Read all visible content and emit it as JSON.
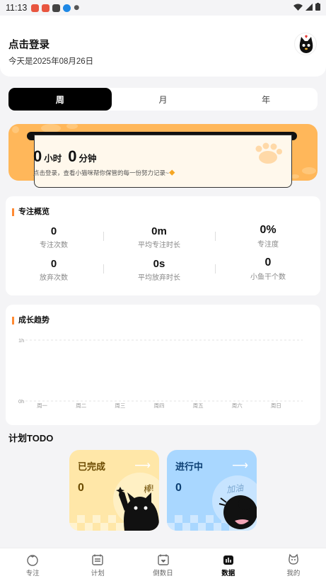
{
  "status_bar": {
    "time": "11:13"
  },
  "header": {
    "title": "点击登录",
    "date_text": "今天是2025年08月26日"
  },
  "period_tabs": [
    {
      "label": "周",
      "active": true
    },
    {
      "label": "月",
      "active": false
    },
    {
      "label": "年",
      "active": false
    }
  ],
  "focus_banner": {
    "hours": "0",
    "hours_unit": "小时",
    "minutes": "0",
    "minutes_unit": "分钟",
    "hint": "点击登录，查看小猫咪帮你保管的每一份努力记录~"
  },
  "overview": {
    "title": "专注概览",
    "stats": [
      {
        "value": "0",
        "label": "专注次数"
      },
      {
        "value": "0m",
        "label": "平均专注时长"
      },
      {
        "value": "0%",
        "label": "专注度"
      },
      {
        "value": "0",
        "label": "放弃次数"
      },
      {
        "value": "0s",
        "label": "平均放弃时长"
      },
      {
        "value": "0",
        "label": "小鱼干个数"
      }
    ]
  },
  "growth": {
    "title": "成长趋势",
    "chart_data": {
      "type": "bar",
      "categories": [
        "周一",
        "周二",
        "周三",
        "周四",
        "周五",
        "周六",
        "周日"
      ],
      "values": [
        0,
        0,
        0,
        0,
        0,
        0,
        0
      ],
      "y_ticks": [
        "1h",
        "0h"
      ],
      "ylim": [
        0,
        1
      ],
      "grid": true
    }
  },
  "todo": {
    "title": "计划TODO",
    "cards": [
      {
        "label": "已完成",
        "count": "0",
        "doodle": "棒!",
        "color": "#ffe7a8",
        "text_color": "#6b4a00"
      },
      {
        "label": "进行中",
        "count": "0",
        "doodle": "加油",
        "color": "#a9d7ff",
        "text_color": "#0c3f73"
      }
    ]
  },
  "tabbar": {
    "items": [
      {
        "label": "专注",
        "icon": "tomato-icon"
      },
      {
        "label": "计划",
        "icon": "calendar-list-icon"
      },
      {
        "label": "倒数日",
        "icon": "calendar-heart-icon"
      },
      {
        "label": "数据",
        "icon": "chart-icon",
        "active": true
      },
      {
        "label": "我的",
        "icon": "cat-face-icon"
      }
    ]
  },
  "colors": {
    "accent": "#ff8a33",
    "banner": "#ffb75a",
    "active_tab": "#000000"
  }
}
